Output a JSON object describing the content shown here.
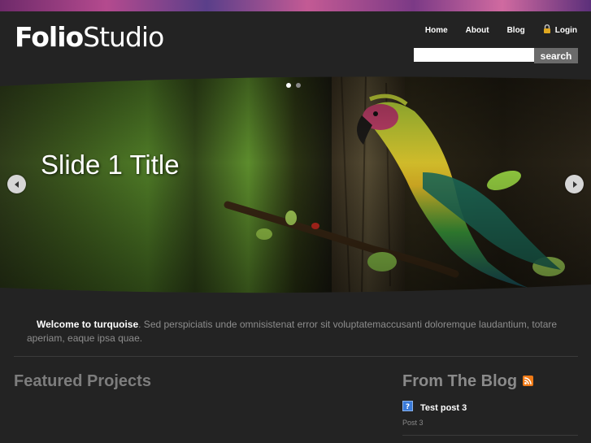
{
  "header": {
    "logo_bold": "Folio",
    "logo_light": "Studio",
    "nav": [
      {
        "label": "Home"
      },
      {
        "label": "About"
      },
      {
        "label": "Blog"
      },
      {
        "label": "Login",
        "icon": "lock-icon"
      }
    ],
    "search": {
      "value": "",
      "button_label": "search"
    }
  },
  "slider": {
    "slide_title": "Slide 1 Title",
    "current_slide": 1,
    "total_slides": 2
  },
  "welcome": {
    "strong": "Welcome to turquoise",
    "text": ". Sed perspiciatis unde omnisistenat error sit voluptatemaccusanti doloremque laudantium, totare aperiam, eaque ipsa quae."
  },
  "sections": {
    "featured_title": "Featured Projects",
    "blog_title": "From The Blog"
  },
  "blog_posts": [
    {
      "title": "Test post 3",
      "subtitle": "Post 3"
    }
  ],
  "colors": {
    "background": "#232323",
    "accent_rss": "#f07a16"
  }
}
